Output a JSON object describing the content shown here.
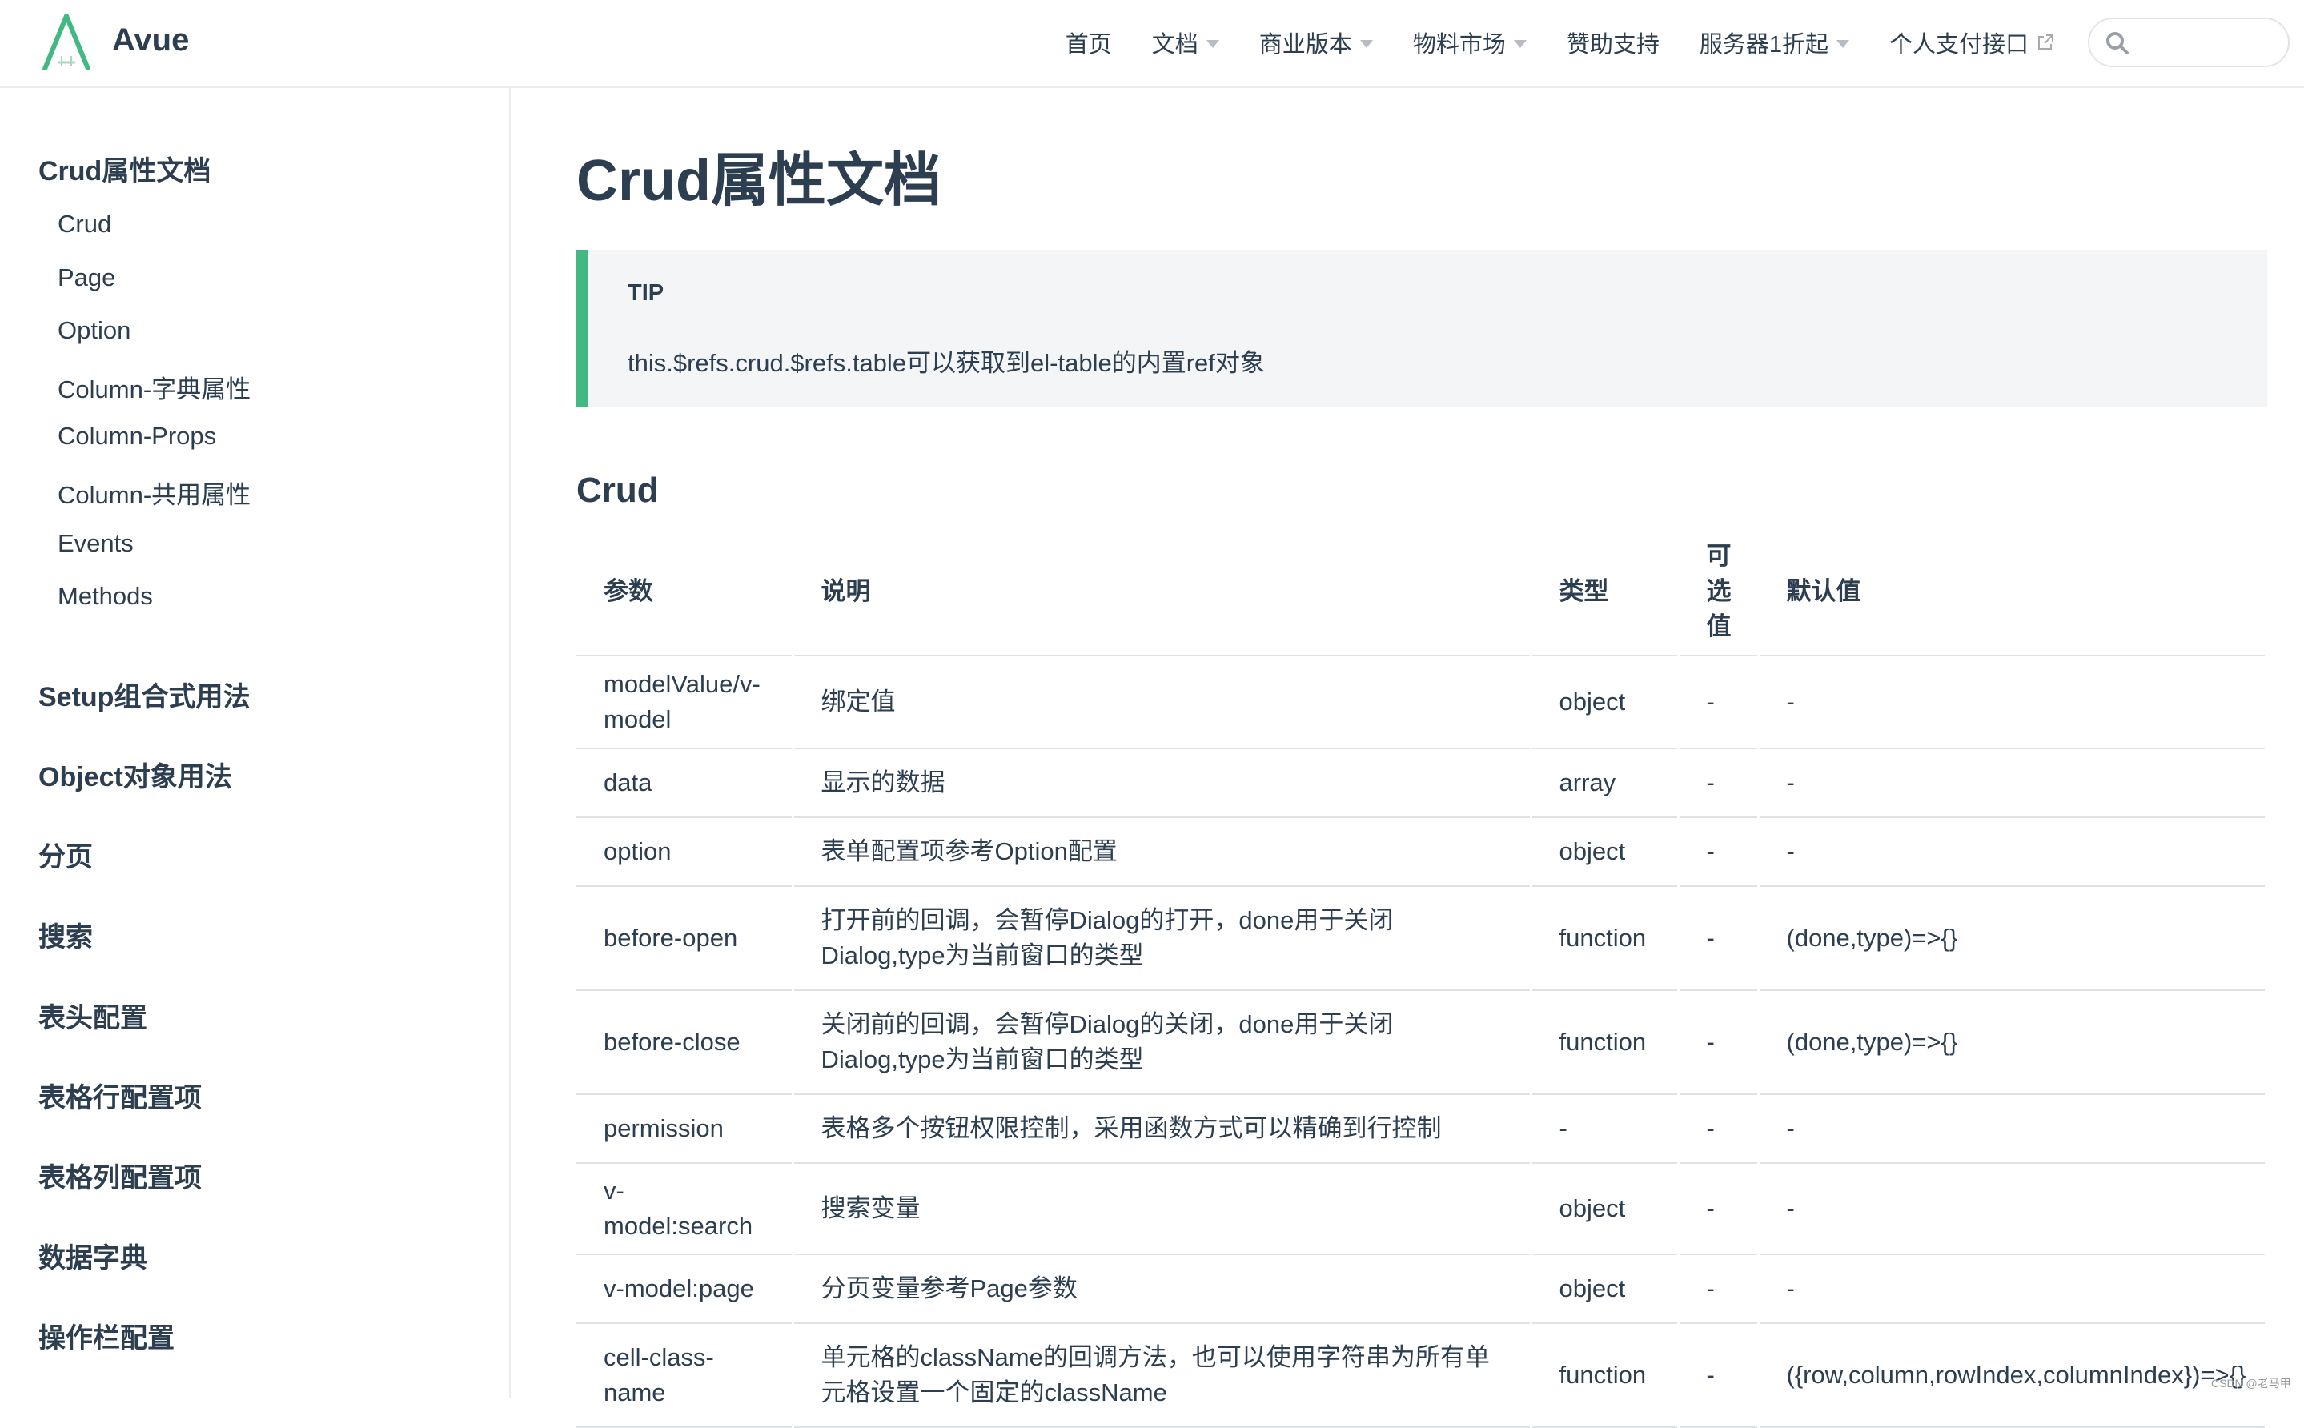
{
  "header": {
    "site_name": "Avue",
    "nav": [
      {
        "label": "首页",
        "has_dropdown": false
      },
      {
        "label": "文档",
        "has_dropdown": true
      },
      {
        "label": "商业版本",
        "has_dropdown": true
      },
      {
        "label": "物料市场",
        "has_dropdown": true
      },
      {
        "label": "赞助支持",
        "has_dropdown": false
      },
      {
        "label": "服务器1折起",
        "has_dropdown": true
      },
      {
        "label": "个人支付接口",
        "has_dropdown": false,
        "external": true
      }
    ],
    "search_placeholder": ""
  },
  "sidebar": {
    "group_title": "Crud属性文档",
    "items": [
      "Crud",
      "Page",
      "Option",
      "Column-字典属性",
      "Column-Props",
      "Column-共用属性",
      "Events",
      "Methods"
    ],
    "groups": [
      "Setup组合式用法",
      "Object对象用法",
      "分页",
      "搜索",
      "表头配置",
      "表格行配置项",
      "表格列配置项",
      "数据字典",
      "操作栏配置"
    ]
  },
  "main": {
    "page_title": "Crud属性文档",
    "tip": {
      "title": "TIP",
      "text": "this.$refs.crud.$refs.table可以获取到el-table的内置ref对象"
    },
    "section_title": "Crud",
    "table": {
      "headers": [
        "参数",
        "说明",
        "类型",
        "可选值",
        "默认值"
      ],
      "rows": [
        [
          "modelValue/v-model",
          "绑定值",
          "object",
          "-",
          "-"
        ],
        [
          "data",
          "显示的数据",
          "array",
          "-",
          "-"
        ],
        [
          "option",
          "表单配置项参考Option配置",
          "object",
          "-",
          "-"
        ],
        [
          "before-open",
          "打开前的回调，会暂停Dialog的打开，done用于关闭Dialog,type为当前窗口的类型",
          "function",
          "-",
          "(done,type)=>{}"
        ],
        [
          "before-close",
          "关闭前的回调，会暂停Dialog的关闭，done用于关闭Dialog,type为当前窗口的类型",
          "function",
          "-",
          "(done,type)=>{}"
        ],
        [
          "permission",
          "表格多个按钮权限控制，采用函数方式可以精确到行控制",
          "-",
          "-",
          "-"
        ],
        [
          "v-model:search",
          "搜索变量",
          "object",
          "-",
          "-"
        ],
        [
          "v-model:page",
          "分页变量参考Page参数",
          "object",
          "-",
          "-"
        ],
        [
          "cell-class-name",
          "单元格的className的回调方法，也可以使用字符串为所有单元格设置一个固定的className",
          "function",
          "-",
          "({row,column,rowIndex,columnIndex})=>{}"
        ]
      ]
    }
  },
  "watermark": "CSDN @老马甲",
  "colors": {
    "accent": "#42b983",
    "text": "#2c3e50",
    "tip_bg": "#f3f5f7",
    "border": "#eaecef"
  }
}
